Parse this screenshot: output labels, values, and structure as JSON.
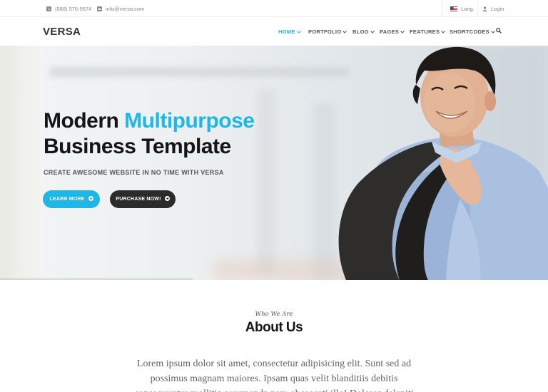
{
  "topbar": {
    "phone": "(888) 576-5674",
    "email": "info@versa.com",
    "lang": "Lang.",
    "login": "Login"
  },
  "header": {
    "logo": "VERSA",
    "nav": [
      {
        "label": "HOME",
        "active": true
      },
      {
        "label": "PORTFOLIO"
      },
      {
        "label": "BLOG"
      },
      {
        "label": "PAGES"
      },
      {
        "label": "FEATURES"
      },
      {
        "label": "SHORTCODES"
      }
    ]
  },
  "hero": {
    "title_part1": "Modern",
    "title_accent": "Multipurpose",
    "title_line2": "Business Template",
    "subtitle": "CREATE AWESOME WEBSITE IN NO TIME WITH VERSA",
    "btn_primary": "LEARN MORE",
    "btn_secondary": "PURCHASE NOW!"
  },
  "about": {
    "kicker": "Who We Are",
    "title": "About Us",
    "text": "Lorem ipsum dolor sit amet, consectetur adipisicing elit. Sunt sed ad possimus magnam maiores. Ipsam quas velit blanditiis debitis consequuntur mollitia assumenda nam obcaecati illo! Dolores deleniti"
  },
  "colors": {
    "accent": "#1fb6e8",
    "dark_button": "#2b2b2b"
  }
}
